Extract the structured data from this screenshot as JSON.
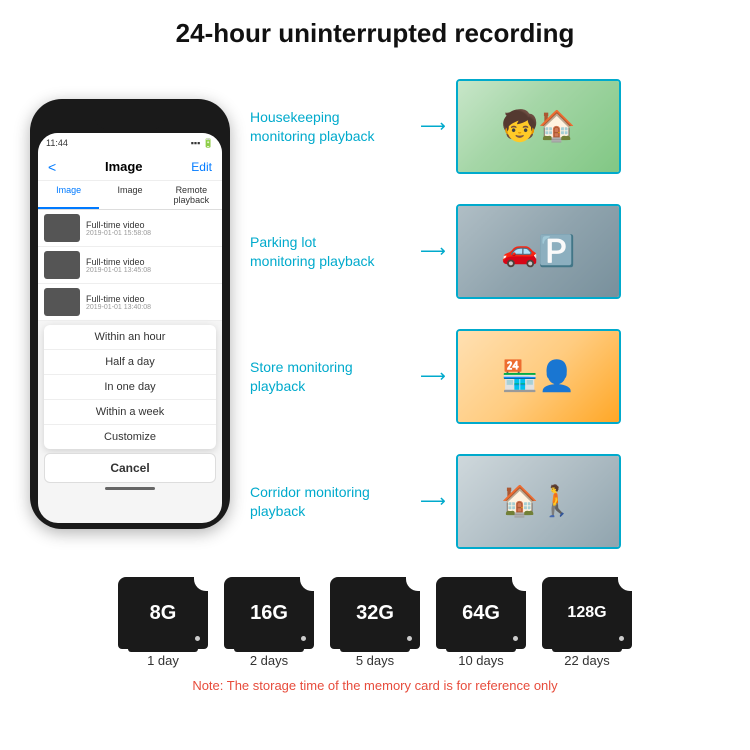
{
  "header": {
    "title": "24-hour uninterrupted recording"
  },
  "phone": {
    "time": "11:44",
    "nav_title": "Image",
    "nav_edit": "Edit",
    "nav_back": "<",
    "tabs": [
      "Image",
      "Image",
      "Remote playback"
    ],
    "active_tab": 0,
    "list_items": [
      {
        "title": "Full-time video",
        "date": "2019-01-01 15:58:08"
      },
      {
        "title": "Full-time video",
        "date": "2019-01-01 13:45:08"
      },
      {
        "title": "Full-time video",
        "date": "2019-01-01 13:40:08"
      }
    ],
    "dropdown_items": [
      "Within an hour",
      "Half a day",
      "In one day",
      "Within a week",
      "Customize"
    ],
    "cancel_label": "Cancel"
  },
  "monitoring": [
    {
      "label": "Housekeeping\nmonitoring playback",
      "emoji": "🧒"
    },
    {
      "label": "Parking lot\nmonitoring playback",
      "emoji": "🚗"
    },
    {
      "label": "Store monitoring\nplayback",
      "emoji": "🏪"
    },
    {
      "label": "Corridor monitoring\nplayback",
      "emoji": "🏠"
    }
  ],
  "storage": {
    "cards": [
      {
        "label": "8G",
        "days": "1 day"
      },
      {
        "label": "16G",
        "days": "2 days"
      },
      {
        "label": "32G",
        "days": "5 days"
      },
      {
        "label": "64G",
        "days": "10 days"
      },
      {
        "label": "128G",
        "days": "22 days"
      }
    ],
    "note": "Note: The storage time of the memory card is for reference only"
  }
}
